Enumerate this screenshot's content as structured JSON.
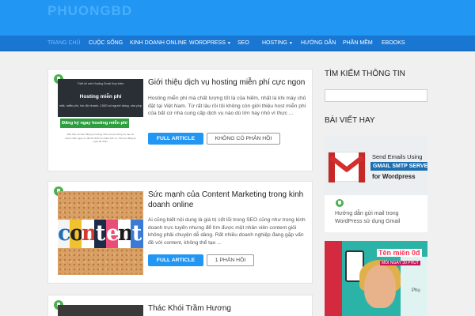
{
  "site": {
    "logo": "PHUONGBD"
  },
  "nav": [
    {
      "label": "Trang chủ",
      "active": true,
      "dropdown": false
    },
    {
      "label": "Cuộc sống",
      "active": false,
      "dropdown": false
    },
    {
      "label": "Kinh doanh online",
      "active": false,
      "dropdown": false
    },
    {
      "label": "Wordpress",
      "active": false,
      "dropdown": true
    },
    {
      "label": "SEO",
      "active": false,
      "dropdown": false
    },
    {
      "label": "Hosting",
      "active": false,
      "dropdown": true
    },
    {
      "label": "Hướng dẫn",
      "active": false,
      "dropdown": false
    },
    {
      "label": "Phần mềm",
      "active": false,
      "dropdown": false
    },
    {
      "label": "Ebooks",
      "active": false,
      "dropdown": false
    }
  ],
  "posts": [
    {
      "title": "Giới thiệu dịch vụ hosting miễn phí cực ngon",
      "excerpt": "Hosting miễn phí mà chất lượng tốt là của hiếm, nhất là khi máy chủ đặt tại Việt Nam. Từ rất lâu rồi tôi không còn giới thiệu host miễn phí của bất cứ nhà cung cấp dịch vụ nào dù lớn hay nhỏ vì thực ...",
      "read_label": "Full Article",
      "comments_label": "Không có phản hồi",
      "thumb": {
        "top_links": "Thiết kế web   Hosting   Email   Hợp thêm",
        "headline": "Hosting miễn phí",
        "subline": "mãi, miễn phí, tốc độ nhanh, 1000 số người dùng, cho php",
        "cta": "Đăng ký ngay hosting miễn phí",
        "fine_print": "Đặc biệt, khi bạn đăng ký hosting miễn phí tại chúng tôi, bạn sẽ được nhận ngay ưu đãi tốt nhất với nhiều dịch vụ. Tiếp tục đăng ký ngay để nhận."
      }
    },
    {
      "title": "Sức mạnh của Content Marketing trong kinh doanh online",
      "excerpt": "Ai cũng biết nội dung là giá trị cốt lõi trong SEO cũng như trong kinh doanh trực tuyến nhưng để tìm được một nhân viên content giỏi không phải chuyện dễ dàng. Rất nhiều doanh nghiệp đang gặp vấn đề với content, không thể tạo ...",
      "read_label": "Full Article",
      "comments_label": "1 phản hồi",
      "thumb": {
        "letters": [
          "c",
          "o",
          "n",
          "t",
          "e",
          "n",
          "t"
        ]
      }
    },
    {
      "title": "Thác Khói Trầm Hương"
    }
  ],
  "sidebar": {
    "search_heading": "Tìm kiếm thông tin",
    "articles_heading": "Bài viết hay",
    "cards": [
      {
        "caption": "Hướng dẫn gửi mail trong WordPress sử dụng Gmail",
        "img_line1": "Send Emails Using",
        "img_line2": "GMAIL SMTP SERVE",
        "img_line3": "for Wordpress"
      },
      {
        "img_text1": "Tên miền 0đ",
        "img_text2": "MỖI NGÀY 30 PHÚT",
        "img_side": "Phụ"
      }
    ]
  },
  "colors": {
    "header": "#2196f3",
    "nav": "#1976d2",
    "button": "#2196f3",
    "badge": "#4caf50"
  }
}
